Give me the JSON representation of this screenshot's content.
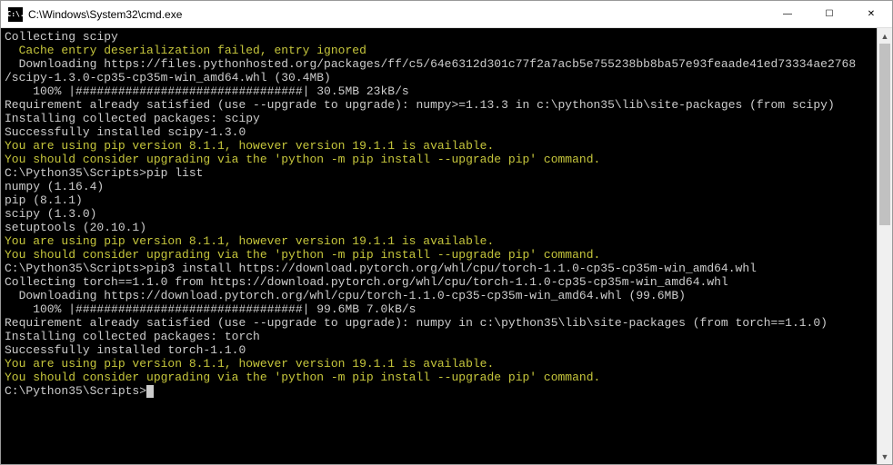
{
  "window": {
    "icon_text": "C:\\.",
    "title": "C:\\Windows\\System32\\cmd.exe"
  },
  "controls": {
    "minimize": "—",
    "maximize": "☐",
    "close": "✕"
  },
  "scrollbar": {
    "up": "▲",
    "down": "▼"
  },
  "lines": [
    {
      "cls": "c-white",
      "text": "Collecting scipy"
    },
    {
      "cls": "c-yellow",
      "text": "  Cache entry deserialization failed, entry ignored"
    },
    {
      "cls": "c-white",
      "text": "  Downloading https://files.pythonhosted.org/packages/ff/c5/64e6312d301c77f2a7acb5e755238bb8ba57e93feaade41ed73334ae2768"
    },
    {
      "cls": "c-white",
      "text": "/scipy-1.3.0-cp35-cp35m-win_amd64.whl (30.4MB)"
    },
    {
      "cls": "c-white",
      "text": "    100% |################################| 30.5MB 23kB/s"
    },
    {
      "cls": "c-white",
      "text": "Requirement already satisfied (use --upgrade to upgrade): numpy>=1.13.3 in c:\\python35\\lib\\site-packages (from scipy)"
    },
    {
      "cls": "c-white",
      "text": "Installing collected packages: scipy"
    },
    {
      "cls": "c-white",
      "text": "Successfully installed scipy-1.3.0"
    },
    {
      "cls": "c-yellow",
      "text": "You are using pip version 8.1.1, however version 19.1.1 is available."
    },
    {
      "cls": "c-yellow",
      "text": "You should consider upgrading via the 'python -m pip install --upgrade pip' command."
    },
    {
      "cls": "c-white",
      "text": ""
    },
    {
      "cls": "c-white",
      "text": "C:\\Python35\\Scripts>pip list"
    },
    {
      "cls": "c-white",
      "text": "numpy (1.16.4)"
    },
    {
      "cls": "c-white",
      "text": "pip (8.1.1)"
    },
    {
      "cls": "c-white",
      "text": "scipy (1.3.0)"
    },
    {
      "cls": "c-white",
      "text": "setuptools (20.10.1)"
    },
    {
      "cls": "c-yellow",
      "text": "You are using pip version 8.1.1, however version 19.1.1 is available."
    },
    {
      "cls": "c-yellow",
      "text": "You should consider upgrading via the 'python -m pip install --upgrade pip' command."
    },
    {
      "cls": "c-white",
      "text": ""
    },
    {
      "cls": "c-white",
      "text": "C:\\Python35\\Scripts>pip3 install https://download.pytorch.org/whl/cpu/torch-1.1.0-cp35-cp35m-win_amd64.whl"
    },
    {
      "cls": "c-white",
      "text": "Collecting torch==1.1.0 from https://download.pytorch.org/whl/cpu/torch-1.1.0-cp35-cp35m-win_amd64.whl"
    },
    {
      "cls": "c-white",
      "text": "  Downloading https://download.pytorch.org/whl/cpu/torch-1.1.0-cp35-cp35m-win_amd64.whl (99.6MB)"
    },
    {
      "cls": "c-white",
      "text": "    100% |################################| 99.6MB 7.0kB/s"
    },
    {
      "cls": "c-white",
      "text": "Requirement already satisfied (use --upgrade to upgrade): numpy in c:\\python35\\lib\\site-packages (from torch==1.1.0)"
    },
    {
      "cls": "c-white",
      "text": "Installing collected packages: torch"
    },
    {
      "cls": "c-white",
      "text": "Successfully installed torch-1.1.0"
    },
    {
      "cls": "c-yellow",
      "text": "You are using pip version 8.1.1, however version 19.1.1 is available."
    },
    {
      "cls": "c-yellow",
      "text": "You should consider upgrading via the 'python -m pip install --upgrade pip' command."
    },
    {
      "cls": "c-white",
      "text": ""
    }
  ],
  "prompt": "C:\\Python35\\Scripts>"
}
